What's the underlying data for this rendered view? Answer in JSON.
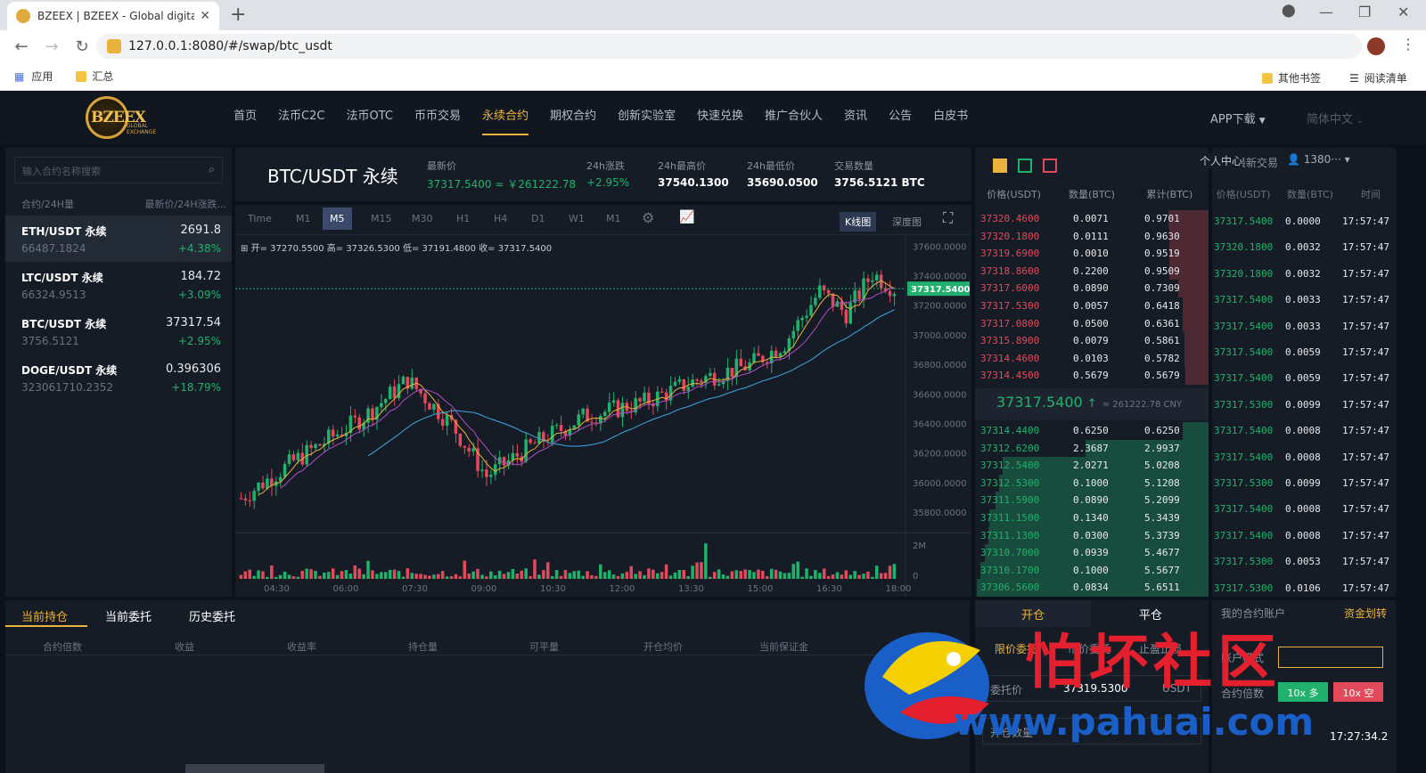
{
  "browser": {
    "tab_title": "BZEEX | BZEEX - Global digital",
    "url": "127.0.0.1:8080/#/swap/btc_usdt",
    "bookmarks": [
      "应用",
      "汇总"
    ],
    "bookmarks_right": [
      "其他书签",
      "阅读清单"
    ]
  },
  "header": {
    "logo_text": "BZEEX",
    "logo_sub": "GLOBAL EXCHANGE",
    "menu": [
      "首页",
      "法币C2C",
      "法币OTC",
      "币币交易",
      "永续合约",
      "期权合约",
      "创新实验室",
      "快速兑换",
      "推广合伙人",
      "资讯",
      "公告",
      "白皮书"
    ],
    "active_index": 4,
    "app_download": "APP下载",
    "language": "简体中文"
  },
  "markets": {
    "search_placeholder": "输入合约名称搜索",
    "col_left": "合约/24H量",
    "col_right": "最新价/24H涨跌...",
    "items": [
      {
        "name": "ETH/USDT 永续",
        "volume": "66487.1824",
        "price": "2691.8",
        "change": "+4.38%"
      },
      {
        "name": "LTC/USDT 永续",
        "volume": "66324.9513",
        "price": "184.72",
        "change": "+3.09%"
      },
      {
        "name": "BTC/USDT 永续",
        "volume": "3756.5121",
        "price": "37317.54",
        "change": "+2.95%"
      },
      {
        "name": "DOGE/USDT 永续",
        "volume": "323061710.2352",
        "price": "0.396306",
        "change": "+18.79%"
      }
    ]
  },
  "ticker": {
    "pair": "BTC/USDT 永续",
    "last_label": "最新价",
    "last_value": "37317.5400 ≈ ￥261222.78",
    "change_label": "24h涨跌",
    "change_value": "+2.95%",
    "high_label": "24h最高价",
    "high_value": "37540.1300",
    "low_label": "24h最低价",
    "low_value": "35690.0500",
    "vol_label": "交易数量",
    "vol_value": "3756.5121 BTC"
  },
  "chart_toolbar": {
    "intervals": [
      "Time",
      "M1",
      "M5",
      "M15",
      "M30",
      "H1",
      "H4",
      "D1",
      "W1",
      "M1"
    ],
    "active_interval": 2,
    "kline": "K线图",
    "depth": "深度图"
  },
  "chart_data": {
    "type": "candlestick",
    "ohlc_text": {
      "open": "开= 37270.5500",
      "high": "高= 37326.5300",
      "low": "低= 37191.4800",
      "close": "收= 37317.5400"
    },
    "y_ticks": [
      "37600.0000",
      "37400.0000",
      "37200.0000",
      "37000.0000",
      "36800.0000",
      "36600.0000",
      "36400.0000",
      "36200.0000",
      "36000.0000",
      "35800.0000"
    ],
    "y_range": [
      35680,
      37680
    ],
    "x_ticks": [
      "04:30",
      "06:00",
      "07:30",
      "09:00",
      "10:30",
      "12:00",
      "13:30",
      "15:00",
      "16:30",
      "18:00"
    ],
    "last_price_label": "37317.5400",
    "volume_ticks": [
      "2M",
      "0"
    ],
    "colors": {
      "up": "#20b26c",
      "down": "#e04a5a",
      "ma5": "#e9b33e",
      "ma10": "#b04fc7",
      "ma30": "#3fa7e0"
    }
  },
  "orderbook": {
    "headers": [
      "价格(USDT)",
      "数量(BTC)",
      "累计(BTC)"
    ],
    "asks": [
      [
        "37320.4600",
        "0.0071",
        "0.9701"
      ],
      [
        "37320.1800",
        "0.0111",
        "0.9630"
      ],
      [
        "37319.6900",
        "0.0010",
        "0.9519"
      ],
      [
        "37318.8600",
        "0.2200",
        "0.9509"
      ],
      [
        "37317.6000",
        "0.0890",
        "0.7309"
      ],
      [
        "37317.5300",
        "0.0057",
        "0.6418"
      ],
      [
        "37317.0800",
        "0.0500",
        "0.6361"
      ],
      [
        "37315.8900",
        "0.0079",
        "0.5861"
      ],
      [
        "37314.4600",
        "0.0103",
        "0.5782"
      ],
      [
        "37314.4500",
        "0.5679",
        "0.5679"
      ]
    ],
    "mid_price": "37317.5400",
    "mid_arrow": "↑",
    "mid_cny": "≈ 261222.78 CNY",
    "bids": [
      [
        "37314.4400",
        "0.6250",
        "0.6250"
      ],
      [
        "37312.6200",
        "2.3687",
        "2.9937"
      ],
      [
        "37312.5400",
        "2.0271",
        "5.0208"
      ],
      [
        "37312.5300",
        "0.1000",
        "5.1208"
      ],
      [
        "37311.5900",
        "0.0890",
        "5.2099"
      ],
      [
        "37311.1500",
        "0.1340",
        "5.3439"
      ],
      [
        "37311.1300",
        "0.0300",
        "5.3739"
      ],
      [
        "37310.7000",
        "0.0939",
        "5.4677"
      ],
      [
        "37310.1700",
        "0.1000",
        "5.5677"
      ],
      [
        "37306.5600",
        "0.0834",
        "5.6511"
      ]
    ]
  },
  "trades": {
    "title": "最新交易",
    "user_center": "个人中心",
    "user": "1380···",
    "headers": [
      "价格(USDT)",
      "数量(BTC)",
      "时间"
    ],
    "rows": [
      [
        "37317.5400",
        "0.0000",
        "17:57:47",
        "g"
      ],
      [
        "37320.1800",
        "0.0032",
        "17:57:47",
        "g"
      ],
      [
        "37320.1800",
        "0.0032",
        "17:57:47",
        "g"
      ],
      [
        "37317.5400",
        "0.0033",
        "17:57:47",
        "g"
      ],
      [
        "37317.5400",
        "0.0033",
        "17:57:47",
        "g"
      ],
      [
        "37317.5400",
        "0.0059",
        "17:57:47",
        "g"
      ],
      [
        "37317.5400",
        "0.0059",
        "17:57:47",
        "g"
      ],
      [
        "37317.5300",
        "0.0099",
        "17:57:47",
        "g"
      ],
      [
        "37317.5400",
        "0.0008",
        "17:57:47",
        "g"
      ],
      [
        "37317.5400",
        "0.0008",
        "17:57:47",
        "g"
      ],
      [
        "37317.5300",
        "0.0099",
        "17:57:47",
        "g"
      ],
      [
        "37317.5400",
        "0.0008",
        "17:57:47",
        "g"
      ],
      [
        "37317.5400",
        "0.0008",
        "17:57:47",
        "g"
      ],
      [
        "37317.5300",
        "0.0053",
        "17:57:47",
        "g"
      ],
      [
        "37317.5300",
        "0.0106",
        "17:57:47",
        "g"
      ]
    ]
  },
  "bottom": {
    "tabs": [
      "当前持仓",
      "当前委托",
      "历史委托"
    ],
    "columns": [
      "合约倍数",
      "收益",
      "收益率",
      "持仓量",
      "可平量",
      "开仓均价",
      "当前保证金"
    ]
  },
  "order_panel": {
    "tabs": [
      "开仓",
      "平仓"
    ],
    "types": [
      "限价委托",
      "市价委托",
      "止盈止损"
    ],
    "price_label": "委托价",
    "price_value": "37319.5300",
    "unit": "USDT",
    "amount_label": "开仓数量"
  },
  "account": {
    "title": "我的合约账户",
    "transfer": "资金划转",
    "mode_label": "账户模式",
    "leverage_label": "合约倍数",
    "long": "10x 多",
    "short": "10x 空",
    "time": "17:27:34.2"
  },
  "watermark": {
    "title": "怕坏社区",
    "url": "www.pahuai.com"
  }
}
